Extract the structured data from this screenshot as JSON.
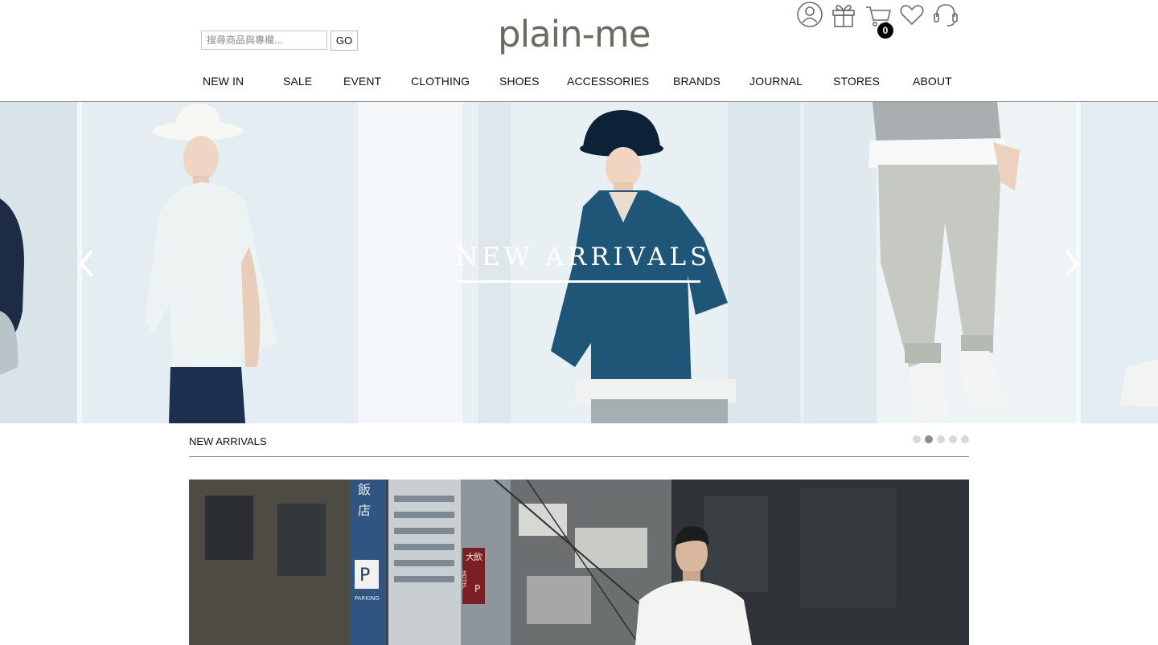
{
  "header": {
    "search": {
      "placeholder": "搜尋商品與專欄...",
      "value": "",
      "button_label": "GO"
    },
    "logo_text": "plain-me",
    "icons": [
      "account-icon",
      "gift-icon",
      "cart-icon",
      "wishlist-heart-icon",
      "customer-service-headset-icon"
    ],
    "cart_count": "0"
  },
  "nav": {
    "items": [
      {
        "label": "NEW IN"
      },
      {
        "label": "SALE"
      },
      {
        "label": "EVENT"
      },
      {
        "label": "CLOTHING"
      },
      {
        "label": "SHOES"
      },
      {
        "label": "ACCESSORIES"
      },
      {
        "label": "BRANDS"
      },
      {
        "label": "JOURNAL"
      },
      {
        "label": "STORES"
      },
      {
        "label": "ABOUT"
      }
    ]
  },
  "hero": {
    "title": "NEW ARRIVALS",
    "prev_icon": "chevron-left-icon",
    "next_icon": "chevron-right-icon"
  },
  "section": {
    "title": "NEW ARRIVALS",
    "dots": {
      "count": 5,
      "active_index": 1
    }
  },
  "banner": {
    "signs": [
      "飯",
      "店",
      "P",
      "PARKING",
      "大",
      "飲",
      "HOTEL",
      "P"
    ]
  },
  "colors": {
    "text": "#111111",
    "rule": "#8a8a8a",
    "logo": "#6f6a60",
    "hero_tee": "#1f5678"
  }
}
